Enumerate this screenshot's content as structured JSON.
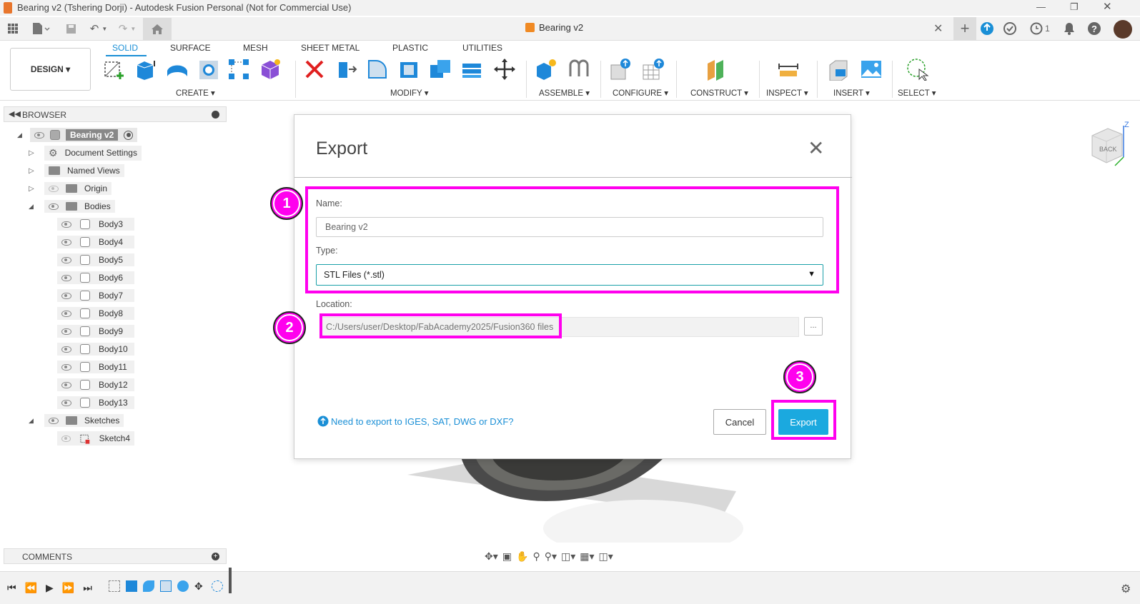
{
  "window": {
    "title": "Bearing v2 (Tshering Dorji) - Autodesk Fusion Personal (Not for Commercial Use)"
  },
  "doc_tab": {
    "label": "Bearing v2"
  },
  "qat": {
    "notifications_count": "1"
  },
  "toolbar": {
    "workspace": "DESIGN ▾",
    "tabs": [
      "SOLID",
      "SURFACE",
      "MESH",
      "SHEET METAL",
      "PLASTIC",
      "UTILITIES"
    ],
    "groups": [
      "CREATE ▾",
      "MODIFY ▾",
      "ASSEMBLE ▾",
      "CONFIGURE ▾",
      "CONSTRUCT ▾",
      "INSPECT ▾",
      "INSERT ▾",
      "SELECT ▾"
    ]
  },
  "browser": {
    "header": "BROWSER",
    "root": "Bearing v2",
    "items": {
      "document_settings": "Document Settings",
      "named_views": "Named Views",
      "origin": "Origin",
      "bodies": "Bodies",
      "sketches": "Sketches"
    },
    "bodies": [
      "Body3",
      "Body4",
      "Body5",
      "Body6",
      "Body7",
      "Body8",
      "Body9",
      "Body10",
      "Body11",
      "Body12",
      "Body13"
    ],
    "sketches": [
      "Sketch4"
    ]
  },
  "comments": {
    "label": "COMMENTS"
  },
  "viewcube": {
    "face": "BACK",
    "axis": "Z"
  },
  "dialog": {
    "title": "Export",
    "name_label": "Name:",
    "name_value": "Bearing v2",
    "type_label": "Type:",
    "type_value": "STL Files (*.stl)",
    "location_label": "Location:",
    "location_value": "C:/Users/user/Desktop/FabAcademy2025/Fusion360 files",
    "browse_label": "...",
    "help_link": "Need to export to IGES, SAT, DWG or DXF?",
    "cancel_label": "Cancel",
    "export_label": "Export"
  },
  "annotations": {
    "step1": "1",
    "step2": "2",
    "step3": "3",
    "color": "#ff00ee"
  },
  "colors": {
    "accent": "#1ba9df",
    "highlight": "#ff00ee",
    "brand": "#e8762d"
  }
}
